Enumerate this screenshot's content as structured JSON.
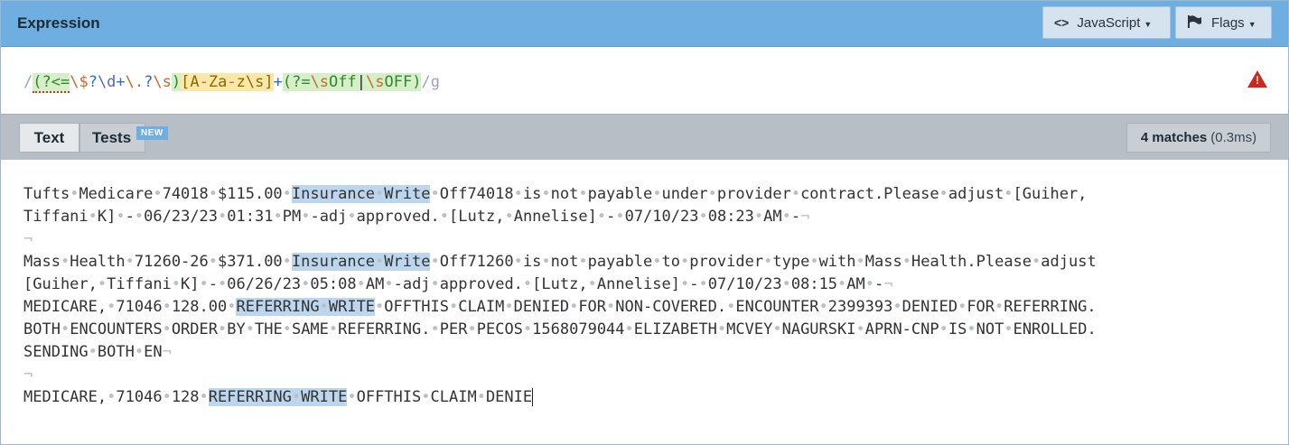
{
  "header": {
    "title": "Expression",
    "language_label": "JavaScript",
    "flags_label": "Flags",
    "language_icon": "code-brackets-icon",
    "flags_icon": "flag-icon"
  },
  "expression": {
    "open_delim": "/",
    "tokens": [
      {
        "text": "(?<=",
        "cls": "t-look-err"
      },
      {
        "text": "\\$",
        "cls": "t-esc"
      },
      {
        "text": "?",
        "cls": "t-quant"
      },
      {
        "text": "\\d",
        "cls": "t-meta"
      },
      {
        "text": "+",
        "cls": "t-quant"
      },
      {
        "text": "\\.",
        "cls": "t-esc"
      },
      {
        "text": "?",
        "cls": "t-quant"
      },
      {
        "text": "\\s",
        "cls": "t-esc"
      },
      {
        "text": ")",
        "cls": "t-look"
      },
      {
        "text": "[A",
        "cls": "t-set"
      },
      {
        "text": "-",
        "cls": "t-set t-range"
      },
      {
        "text": "Za",
        "cls": "t-set"
      },
      {
        "text": "-",
        "cls": "t-set t-range"
      },
      {
        "text": "z",
        "cls": "t-set"
      },
      {
        "text": "\\s",
        "cls": "t-set t-esc"
      },
      {
        "text": "]",
        "cls": "t-set"
      },
      {
        "text": "+",
        "cls": "t-quant"
      },
      {
        "text": "(?=",
        "cls": "t-look"
      },
      {
        "text": "\\s",
        "cls": "t-look t-esc"
      },
      {
        "text": "Off",
        "cls": "t-look"
      },
      {
        "text": "|",
        "cls": "t-look t-alt"
      },
      {
        "text": "\\s",
        "cls": "t-look t-esc"
      },
      {
        "text": "OFF",
        "cls": "t-look"
      },
      {
        "text": ")",
        "cls": "t-look"
      }
    ],
    "close_delim": "/g",
    "error_icon": "warning-triangle-icon",
    "colors": {
      "error": "#d0261b",
      "lookaround_bg": "#d6efc8",
      "set_bg": "#fbe8a8"
    }
  },
  "tabs": {
    "text_label": "Text",
    "tests_label": "Tests",
    "new_badge": "NEW",
    "matches_count": "4 matches",
    "matches_time": "(0.3ms)"
  },
  "text_lines": [
    [
      {
        "t": "Tufts Medicare 74018 $115.00 "
      },
      {
        "t": "Insurance Write",
        "hl": true
      },
      {
        "t": " Off74018 is not payable under provider contract.Please adjust [Guiher,"
      }
    ],
    [
      {
        "t": "Tiffani K] - 06/23/23 01:31 PM -adj approved. [Lutz, Annelise] - 07/10/23 08:23 AM -",
        "nl": true
      }
    ],
    [
      {
        "t": "",
        "nl": true
      }
    ],
    [
      {
        "t": "Mass Health 71260-26 $371.00 "
      },
      {
        "t": "Insurance Write",
        "hl": true
      },
      {
        "t": " Off71260 is not payable to provider type with Mass Health.Please adjust"
      }
    ],
    [
      {
        "t": "[Guiher, Tiffani K] - 06/26/23 05:08 AM -adj approved. [Lutz, Annelise] - 07/10/23 08:15 AM -",
        "nl": true
      }
    ],
    [
      {
        "t": "MEDICARE, 71046 128.00 "
      },
      {
        "t": "REFERRING WRITE",
        "hl": true
      },
      {
        "t": " OFFTHIS CLAIM DENIED FOR NON-COVERED. ENCOUNTER 2399393 DENIED FOR REFERRING."
      }
    ],
    [
      {
        "t": "BOTH ENCOUNTERS ORDER BY THE SAME REFERRING. PER PECOS 1568079044 ELIZABETH MCVEY NAGURSKI APRN-CNP IS NOT ENROLLED."
      }
    ],
    [
      {
        "t": "SENDING BOTH EN",
        "nl": true
      }
    ],
    [
      {
        "t": "",
        "nl": true
      }
    ],
    [
      {
        "t": "MEDICARE, 71046 128 "
      },
      {
        "t": "REFERRING WRITE",
        "hl": true
      },
      {
        "t": " OFFTHIS CLAIM DENIE",
        "cursor": true
      }
    ]
  ]
}
